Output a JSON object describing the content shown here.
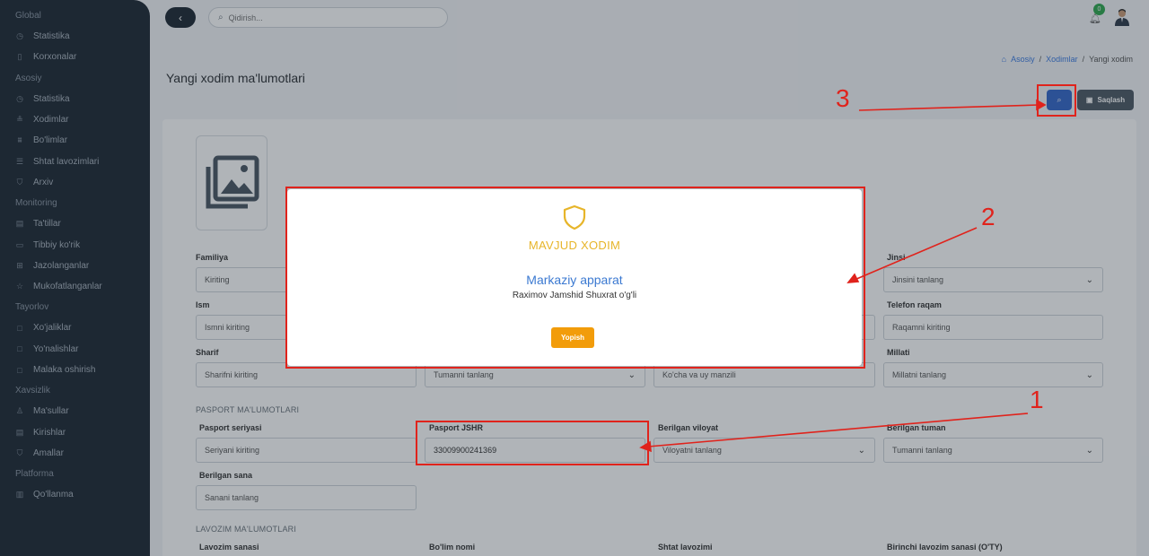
{
  "sidebar": {
    "sections": [
      {
        "title": "Global",
        "items": [
          {
            "label": "Statistika",
            "icon": "clock-icon"
          },
          {
            "label": "Korxonalar",
            "icon": "building-icon"
          }
        ]
      },
      {
        "title": "Asosiy",
        "items": [
          {
            "label": "Statistika",
            "icon": "clock-icon"
          },
          {
            "label": "Xodimlar",
            "icon": "users-icon"
          },
          {
            "label": "Bo'limlar",
            "icon": "org-icon"
          },
          {
            "label": "Shtat lavozimlari",
            "icon": "list-icon"
          },
          {
            "label": "Arxiv",
            "icon": "shield-icon"
          }
        ]
      },
      {
        "title": "Monitoring",
        "items": [
          {
            "label": "Ta'tillar",
            "icon": "calendar-icon"
          },
          {
            "label": "Tibbiy ko'rik",
            "icon": "card-icon"
          },
          {
            "label": "Jazolanganlar",
            "icon": "grid-icon"
          },
          {
            "label": "Mukofatlanganlar",
            "icon": "star-icon"
          }
        ]
      },
      {
        "title": "Tayorlov",
        "items": [
          {
            "label": "Xo'jaliklar",
            "icon": "square-icon"
          },
          {
            "label": "Yo'nalishlar",
            "icon": "square-icon"
          },
          {
            "label": "Malaka oshirish",
            "icon": "square-icon"
          }
        ]
      },
      {
        "title": "Xavsizlik",
        "items": [
          {
            "label": "Ma'sullar",
            "icon": "user-icon"
          },
          {
            "label": "Kirishlar",
            "icon": "doc-icon"
          },
          {
            "label": "Amallar",
            "icon": "shield-icon"
          }
        ]
      },
      {
        "title": "Platforma",
        "items": [
          {
            "label": "Qo'llanma",
            "icon": "book-icon"
          }
        ]
      }
    ]
  },
  "topbar": {
    "search_placeholder": "Qidirish...",
    "notification_count": "0"
  },
  "breadcrumb": {
    "home": "Asosiy",
    "sep": "/",
    "section": "Xodimlar",
    "current": "Yangi xodim"
  },
  "page": {
    "title": "Yangi xodim ma'lumotlari"
  },
  "toolbar": {
    "save_label": "Saqlash"
  },
  "form": {
    "familiya_label": "Familiya",
    "familiya_value": "Kiriting",
    "ism_label": "Ism",
    "ism_value": "Ismni kiriting",
    "sharif_label": "Sharif",
    "sharif_value": "Sharifni kiriting",
    "tuman_value": "Tumanni tanlang",
    "manzil_value": "Ko'cha va uy manzili",
    "jinsi_label": "Jinsi",
    "jinsi_value": "Jinsini tanlang",
    "telefon_label": "Telefon raqam",
    "telefon_value": "Raqamni kiriting",
    "millati_label": "Millati",
    "millati_value": "Millatni tanlang",
    "pasport_section": "PASPORT MA'LUMOTLARI",
    "seriya_label": "Pasport seriyasi",
    "seriya_value": "Seriyani kiriting",
    "jshr_label": "Pasport JSHR",
    "jshr_value": "33009900241369",
    "viloyat_label": "Berilgan viloyat",
    "viloyat_value": "Viloyatni tanlang",
    "b_tuman_label": "Berilgan tuman",
    "b_tuman_value": "Tumanni tanlang",
    "sana_label": "Berilgan sana",
    "sana_value": "Sanani tanlang",
    "lavozim_section": "LAVOZIM MA'LUMOTLARI",
    "lavozim_sanasi_label": "Lavozim sanasi",
    "bolim_nomi_label": "Bo'lim nomi",
    "shtat_label": "Shtat lavozimi",
    "birinchi_label": "Birinchi lavozim sanasi (O'TY)"
  },
  "modal": {
    "title": "MAVJUD XODIM",
    "organization": "Markaziy apparat",
    "name": "Raximov Jamshid Shuxrat o'g'li",
    "close_label": "Yopish"
  },
  "annotations": {
    "n1": "1",
    "n2": "2",
    "n3": "3"
  },
  "colors": {
    "annotation": "#e0231c",
    "modal_title": "#e7b52a",
    "close_button": "#f29c0a",
    "sidebar_bg": "#1e2833",
    "accent": "#3567c9"
  }
}
